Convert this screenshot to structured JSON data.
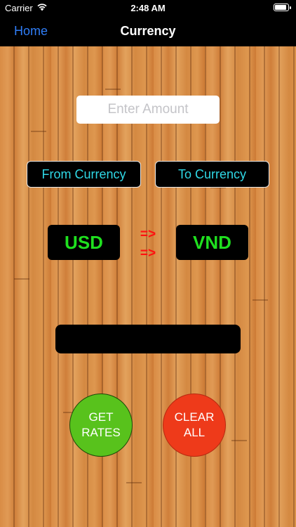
{
  "status_bar": {
    "carrier": "Carrier",
    "time": "2:48 AM",
    "wifi_icon": "wifi-icon",
    "battery_icon": "battery-icon"
  },
  "nav": {
    "back_label": "Home",
    "title": "Currency"
  },
  "form": {
    "amount_placeholder": "Enter Amount",
    "amount_value": "",
    "from_label": "From Currency",
    "to_label": "To Currency",
    "from_code": "USD",
    "to_code": "VND",
    "arrow_1": "=>",
    "arrow_2": "=>",
    "result": ""
  },
  "actions": {
    "get_rates_label": "GET RATES",
    "clear_all_label": "CLEAR ALL"
  },
  "colors": {
    "accent_link": "#2f7df6",
    "select_text": "#2fd8e6",
    "code_text": "#1fe01f",
    "arrow": "#ff1010",
    "get_rates_bg": "#58c21c",
    "clear_all_bg": "#ee3a1a"
  }
}
